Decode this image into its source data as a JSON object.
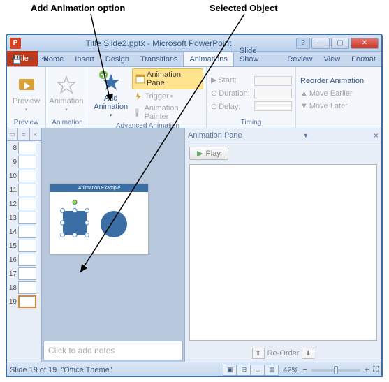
{
  "annotations": {
    "add_anim": "Add Animation option",
    "selected_obj": "Selected Object"
  },
  "window": {
    "title": "Title Slide2.pptx - Microsoft PowerPoint",
    "app_letter": "P"
  },
  "tabs": {
    "file": "File",
    "home": "Home",
    "insert": "Insert",
    "design": "Design",
    "transitions": "Transitions",
    "animations": "Animations",
    "slideshow": "Slide Show",
    "review": "Review",
    "view": "View",
    "format": "Format"
  },
  "ribbon": {
    "preview": "Preview",
    "animation": "Animation",
    "add_animation": "Add Animation",
    "animation_pane": "Animation Pane",
    "trigger": "Trigger",
    "animation_painter": "Animation Painter",
    "adv_group": "Advanced Animation",
    "start": "Start:",
    "duration": "Duration:",
    "delay": "Delay:",
    "timing_group": "Timing",
    "reorder": "Reorder Animation",
    "move_earlier": "Move Earlier",
    "move_later": "Move Later"
  },
  "thumbs": {
    "start": 8,
    "end": 19,
    "selected": 19
  },
  "slide": {
    "title_text": "Animation Example"
  },
  "anim_pane": {
    "title": "Animation Pane",
    "play": "Play",
    "reorder": "Re-Order"
  },
  "notes": {
    "placeholder": "Click to add notes"
  },
  "status": {
    "slide": "Slide 19 of 19",
    "theme": "\"Office Theme\"",
    "zoom": "42%"
  }
}
